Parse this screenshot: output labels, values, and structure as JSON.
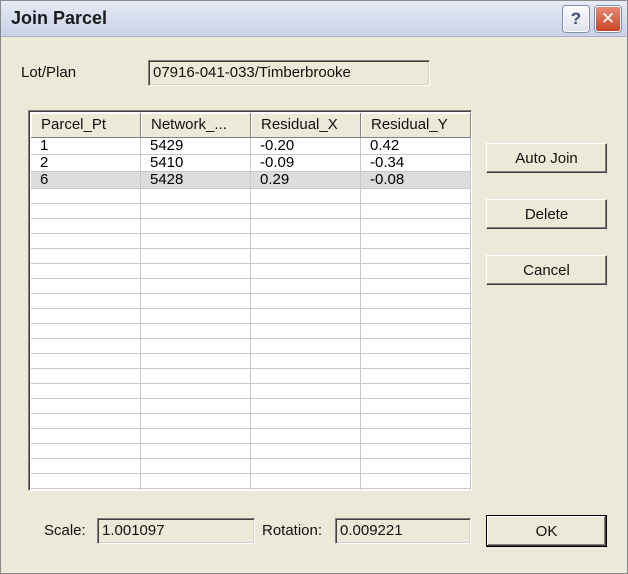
{
  "window": {
    "title": "Join Parcel",
    "help_glyph": "?",
    "close_glyph": "✕"
  },
  "lotplan": {
    "label": "Lot/Plan",
    "value": "07916-041-033/Timberbrooke"
  },
  "table": {
    "columns": [
      "Parcel_Pt",
      "Network_...",
      "Residual_X",
      "Residual_Y"
    ],
    "rows": [
      [
        "1",
        "5429",
        "-0.20",
        " 0.42"
      ],
      [
        "2",
        "5410",
        "-0.09",
        "-0.34"
      ],
      [
        "6",
        "5428",
        " 0.29",
        "-0.08"
      ]
    ],
    "selected_row_index": 2
  },
  "buttons": {
    "auto_join": "Auto Join",
    "delete": "Delete",
    "cancel": "Cancel",
    "ok": "OK"
  },
  "footer": {
    "scale_label": "Scale:",
    "scale_value": "1.001097",
    "rotation_label": "Rotation:",
    "rotation_value": "0.009221"
  }
}
